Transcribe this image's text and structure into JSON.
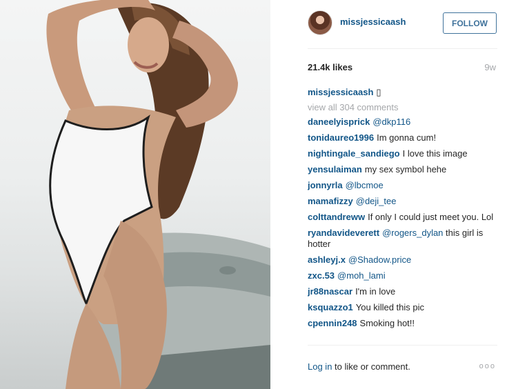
{
  "post": {
    "username": "missjessicaash",
    "follow_label": "FOLLOW",
    "likes": "21.4k likes",
    "age": "9w",
    "caption_user": "missjessicaash",
    "caption_text": "▯",
    "view_all": "view all 304 comments"
  },
  "comments": [
    {
      "user": "daneelyisprick",
      "mention": "@dkp116",
      "text": ""
    },
    {
      "user": "tonidaureo1996",
      "mention": "",
      "text": "Im gonna cum!"
    },
    {
      "user": "nightingale_sandiego",
      "mention": "",
      "text": "I love this image"
    },
    {
      "user": "yensulaiman",
      "mention": "",
      "text": "my sex symbol hehe"
    },
    {
      "user": "jonnyrla",
      "mention": "@lbcmoe",
      "text": ""
    },
    {
      "user": "mamafizzy",
      "mention": "@deji_tee",
      "text": ""
    },
    {
      "user": "colttandreww",
      "mention": "",
      "text": "If only I could just meet you. Lol"
    },
    {
      "user": "ryandavideverett",
      "mention": "@rogers_dylan",
      "text": "this girl is hotter"
    },
    {
      "user": "ashleyj.x",
      "mention": "@Shadow.price",
      "text": ""
    },
    {
      "user": "zxc.53",
      "mention": "@moh_lami",
      "text": ""
    },
    {
      "user": "jr88nascar",
      "mention": "",
      "text": "I'm in love"
    },
    {
      "user": "ksquazzo1",
      "mention": "",
      "text": "You killed this pic"
    },
    {
      "user": "cpennin248",
      "mention": "",
      "text": "Smoking hot!!"
    }
  ],
  "footer": {
    "login_link": "Log in",
    "login_text": " to like or comment.",
    "more_icon": "ooo"
  }
}
